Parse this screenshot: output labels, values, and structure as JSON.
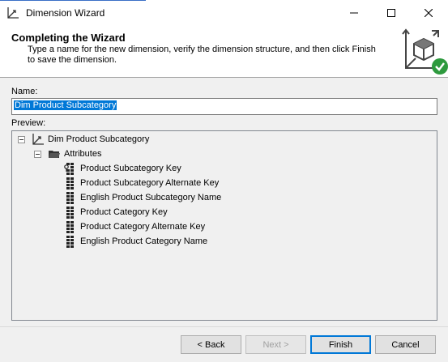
{
  "window": {
    "title": "Dimension Wizard"
  },
  "header": {
    "title": "Completing the Wizard",
    "description": "Type a name for the new dimension, verify the dimension structure, and then click Finish to save the dimension."
  },
  "name_field": {
    "label": "Name:",
    "value": "Dim Product Subcategory"
  },
  "preview": {
    "label": "Preview:",
    "root": "Dim Product Subcategory",
    "folder": "Attributes",
    "attributes": [
      {
        "label": "Product Subcategory Key",
        "icon": "key-attribute-icon"
      },
      {
        "label": "Product Subcategory Alternate Key",
        "icon": "attribute-icon"
      },
      {
        "label": "English Product Subcategory Name",
        "icon": "attribute-icon"
      },
      {
        "label": "Product Category Key",
        "icon": "attribute-icon"
      },
      {
        "label": "Product Category Alternate Key",
        "icon": "attribute-icon"
      },
      {
        "label": "English Product Category Name",
        "icon": "attribute-icon"
      }
    ]
  },
  "buttons": {
    "back": "< Back",
    "next": "Next >",
    "finish": "Finish",
    "cancel": "Cancel"
  },
  "colors": {
    "accent": "#0078d7",
    "success": "#2e9a3e"
  }
}
